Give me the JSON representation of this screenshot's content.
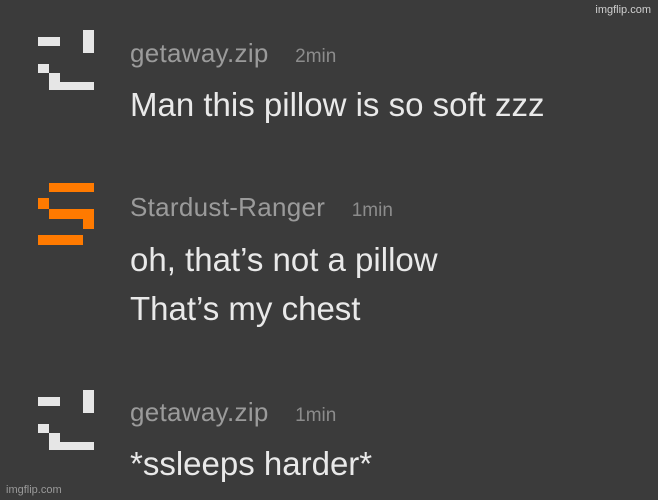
{
  "watermark": "imgflip.com",
  "colors": {
    "background": "#3b3b3b",
    "avatar_white": "#e6e6e6",
    "avatar_orange": "#ff7a00",
    "username": "#9b9b9b",
    "message_text": "#e9e9e9"
  },
  "messages": [
    {
      "username": "getaway.zip",
      "time": "2min",
      "avatar": "pixel-white-icon",
      "lines": [
        "Man this pillow is so soft zzz"
      ]
    },
    {
      "username": "Stardust-Ranger",
      "time": "1min",
      "avatar": "pixel-orange-s-icon",
      "lines": [
        "oh, that’s not a pillow",
        "That’s my chest"
      ]
    },
    {
      "username": "getaway.zip",
      "time": "1min",
      "avatar": "pixel-white-icon",
      "lines": [
        "*ssleeps harder*"
      ]
    }
  ]
}
